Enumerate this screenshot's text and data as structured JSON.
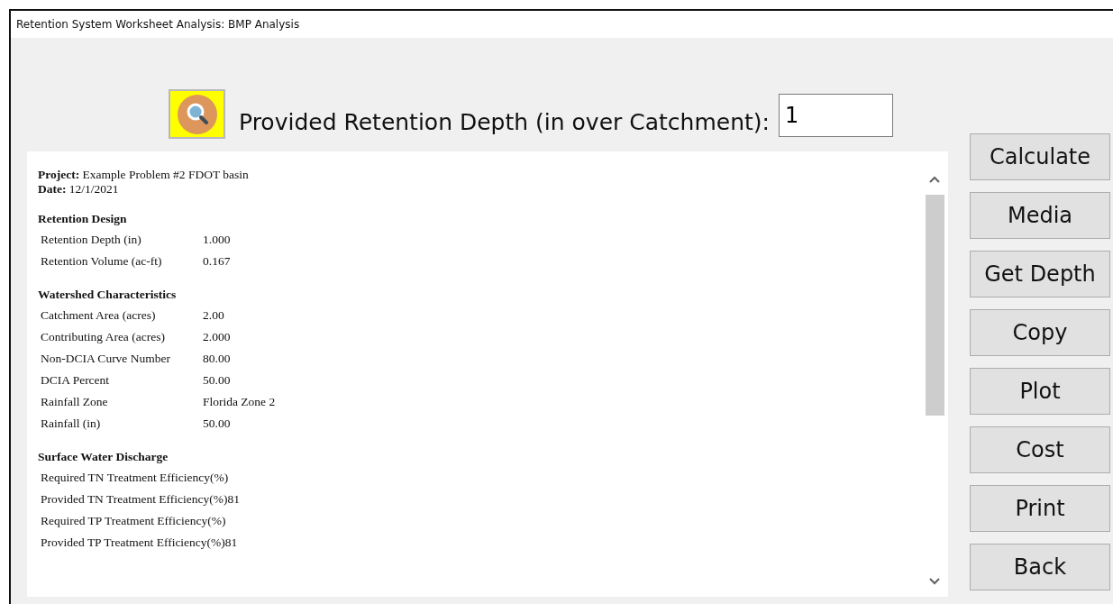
{
  "window": {
    "title": "Retention System Worksheet Analysis: BMP Analysis"
  },
  "depth_field": {
    "label": "Provided Retention Depth (in over Catchment):",
    "value": "1"
  },
  "report": {
    "header": [
      {
        "label": "Project:",
        "value": "Example Problem #2 FDOT basin"
      },
      {
        "label": "Date:",
        "value": "12/1/2021"
      }
    ],
    "sections": [
      {
        "title": "Retention Design",
        "rows": [
          {
            "label": "Retention Depth (in)",
            "value": "1.000"
          },
          {
            "label": "Retention Volume (ac-ft)",
            "value": "0.167"
          }
        ]
      },
      {
        "title": "Watershed Characteristics",
        "rows": [
          {
            "label": "Catchment Area (acres)",
            "value": "2.00"
          },
          {
            "label": "Contributing Area (acres)",
            "value": "2.000"
          },
          {
            "label": "Non-DCIA Curve Number",
            "value": "80.00"
          },
          {
            "label": "DCIA Percent",
            "value": "50.00"
          },
          {
            "label": "Rainfall Zone",
            "value": "Florida Zone 2"
          },
          {
            "label": "Rainfall (in)",
            "value": "50.00"
          }
        ]
      },
      {
        "title": "Surface Water Discharge",
        "rows": [
          {
            "label": "Required TN Treatment Efficiency(%)"
          },
          {
            "label": "Provided TN Treatment Efficiency(%)",
            "value": "81"
          },
          {
            "label": "Required TP Treatment Efficiency(%)"
          },
          {
            "label": "Provided TP Treatment Efficiency(%)",
            "value": "81"
          }
        ]
      }
    ]
  },
  "buttons": [
    "Calculate",
    "Media",
    "Get Depth",
    "Copy",
    "Plot",
    "Cost",
    "Print",
    "Back"
  ]
}
